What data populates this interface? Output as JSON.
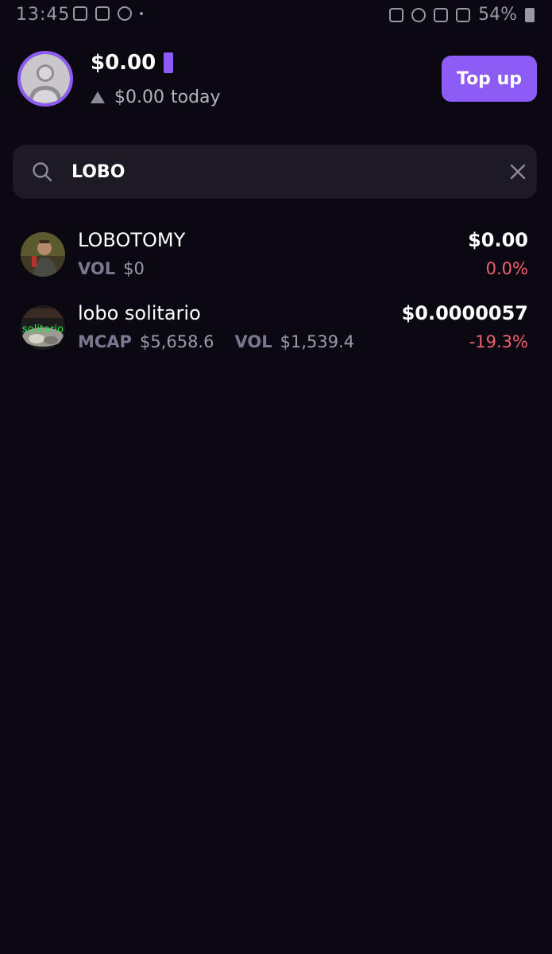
{
  "status_bar": {
    "time": "13:45",
    "battery": "54%"
  },
  "header": {
    "balance": "$0.00",
    "change": "$0.00",
    "change_period": "today",
    "topup_label": "Top up"
  },
  "search": {
    "query": "LOBO"
  },
  "results": [
    {
      "name": "LOBOTOMY",
      "vol_label": "VOL",
      "vol_value": "$0",
      "price": "$0.00",
      "change": "0.0%"
    },
    {
      "name": "lobo solitario",
      "avatar_text": "solitario",
      "mcap_label": "MCAP",
      "mcap_value": "$5,658.6",
      "vol_label": "VOL",
      "vol_value": "$1,539.4",
      "price": "$0.0000057",
      "change": "-19.3%"
    }
  ],
  "colors": {
    "background": "#0c0812",
    "accent": "#8d5cf6",
    "negative": "#f0616f",
    "muted": "#7b7791"
  }
}
